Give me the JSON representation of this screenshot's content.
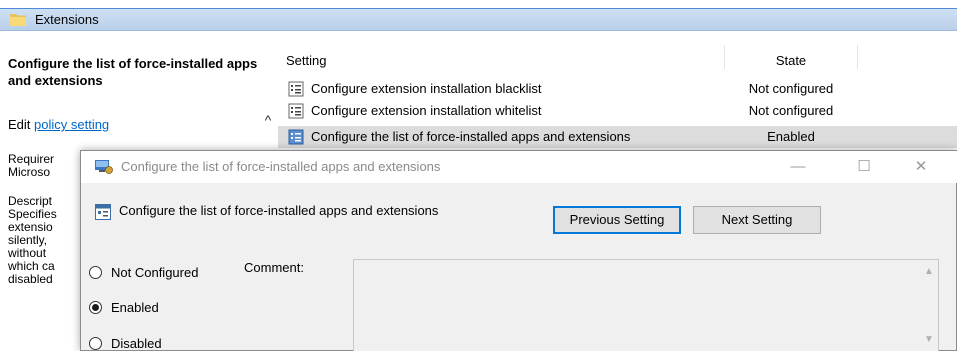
{
  "editor": {
    "folder_title": "Extensions",
    "left_pane": {
      "heading": "Configure the list of force-installed apps and extensions",
      "edit_prefix": "Edit ",
      "edit_link": "policy setting",
      "fragments": [
        "Requirer",
        "Microso",
        "Descript",
        "Specifies",
        "extensio",
        "silently,",
        "without",
        "which ca",
        "disabled"
      ]
    },
    "columns": {
      "setting": "Setting",
      "state": "State"
    },
    "rows": [
      {
        "name": "Configure extension installation blacklist",
        "state": "Not configured"
      },
      {
        "name": "Configure extension installation whitelist",
        "state": "Not configured"
      },
      {
        "name": "Configure the list of force-installed apps and extensions",
        "state": "Enabled"
      }
    ],
    "scroll_up_glyph": "^"
  },
  "dialog": {
    "title": "Configure the list of force-installed apps and extensions",
    "policy_name": "Configure the list of force-installed apps and extensions",
    "prev_button": "Previous Setting",
    "next_button": "Next Setting",
    "minimize_glyph": "—",
    "maximize_glyph": "☐",
    "close_glyph": "✕",
    "options": [
      {
        "label": "Not Configured",
        "selected": false
      },
      {
        "label": "Enabled",
        "selected": true
      },
      {
        "label": "Disabled",
        "selected": false
      }
    ],
    "comment_label": "Comment:",
    "scroll_up_glyph": "▲",
    "scroll_down_glyph": "▼"
  },
  "colors": {
    "accent": "#0078d7",
    "link": "#0066cc",
    "header_blue": "#c4d8ee",
    "selected_row": "#dcdcdc"
  },
  "icons": [
    "folder-icon",
    "policy-setting-icon",
    "policy-app-icon",
    "scroll-up-icon"
  ]
}
